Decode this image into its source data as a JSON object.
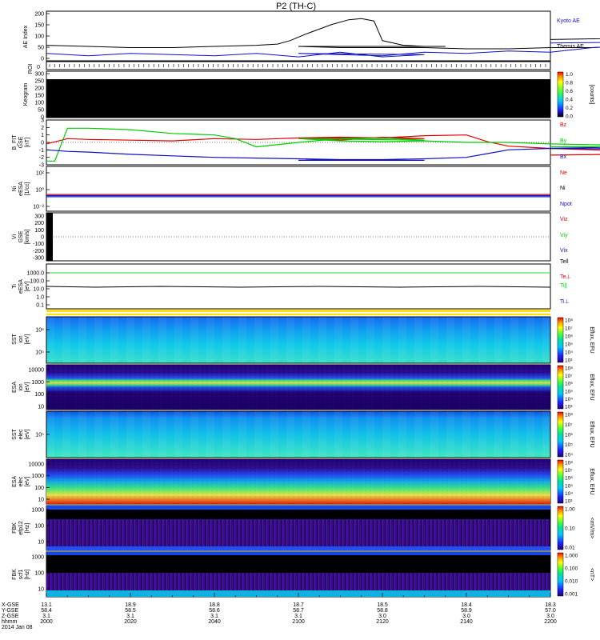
{
  "header": {
    "title": "P2 (TH-C)"
  },
  "chart_data": [
    {
      "type": "line",
      "panel": "ae_index",
      "ylabel": "AE Index",
      "ticks": [
        "200",
        "150",
        "100",
        "50",
        "0"
      ],
      "series": [
        {
          "name": "Themis AE",
          "color": "#000000",
          "x": [
            2000,
            2010,
            2020,
            2030,
            2040,
            2050,
            2055,
            2058,
            2062,
            2068,
            2072,
            2075,
            2078,
            2080,
            2085,
            2090,
            2095,
            2100,
            2110,
            2120,
            2130,
            2140,
            2150,
            2160,
            2170,
            2180,
            2185,
            2190,
            2195,
            2200
          ],
          "values": [
            60,
            55,
            50,
            50,
            55,
            60,
            65,
            80,
            110,
            150,
            170,
            175,
            165,
            80,
            60,
            55,
            55,
            55,
            50,
            50,
            50,
            45,
            45,
            50,
            50,
            60,
            75,
            90,
            95,
            85
          ]
        },
        {
          "name": "Kyoto AE",
          "color": "#1010c0",
          "x": [
            2000,
            2010,
            2020,
            2030,
            2040,
            2050,
            2060,
            2070,
            2080,
            2090,
            2100,
            2110,
            2120,
            2130,
            2140,
            2150,
            2160,
            2170,
            2180,
            2190,
            2200
          ],
          "values": [
            25,
            15,
            25,
            20,
            15,
            25,
            10,
            30,
            10,
            20,
            25,
            20,
            15,
            30,
            25,
            35,
            30,
            50,
            60,
            75,
            70
          ]
        }
      ]
    },
    {
      "type": "heatmap",
      "panel": "roi",
      "ylabel": "ROI",
      "ticks": [
        "0"
      ]
    },
    {
      "type": "heatmap",
      "panel": "keogram",
      "ylabel": "Keogram",
      "ticks": [
        "300",
        "250",
        "200",
        "150",
        "100",
        "50",
        "0"
      ],
      "colorbar": {
        "label": "[counts]",
        "ticks": [
          "1.0",
          "0.8",
          "0.6",
          "0.4",
          "0.2",
          "0.0"
        ]
      }
    },
    {
      "type": "line",
      "panel": "b_field",
      "ylabel": "B_FIT",
      "ylabel2": "GSE",
      "ylabel3": "[nT]",
      "ticks": [
        "3",
        "2",
        "1",
        "0",
        "-1",
        "-2",
        "-3"
      ],
      "ylim": [
        -3,
        3
      ],
      "series": [
        {
          "name": "Bz",
          "color": "#e00000",
          "x": [
            2000,
            2005,
            2010,
            2020,
            2030,
            2040,
            2050,
            2060,
            2070,
            2080,
            2090,
            2100,
            2110,
            2120,
            2130,
            2140,
            2145,
            2150,
            2160,
            2170,
            2180,
            2190,
            2200
          ],
          "values": [
            -0.2,
            0.5,
            0.4,
            0.3,
            0.2,
            0.5,
            0.4,
            0.6,
            0.3,
            0.7,
            0.5,
            0.6,
            0.7,
            0.6,
            0.9,
            1.0,
            0.1,
            -0.5,
            -0.8,
            -1.0,
            -1.3,
            -1.5,
            -1.7
          ]
        },
        {
          "name": "By",
          "color": "#00cc00",
          "x": [
            2000,
            2002,
            2005,
            2010,
            2020,
            2030,
            2040,
            2045,
            2050,
            2060,
            2070,
            2080,
            2090,
            2100,
            2110,
            2120,
            2130,
            2140,
            2150,
            2160,
            2170,
            2180,
            2190,
            2200
          ],
          "values": [
            -2.5,
            -2.5,
            1.9,
            1.9,
            1.7,
            1.2,
            1.0,
            0.5,
            -0.6,
            0.0,
            0.5,
            0.6,
            0.3,
            0.5,
            0.2,
            0.1,
            0.2,
            0.0,
            0.0,
            -0.2,
            -0.3,
            -0.4,
            -0.5,
            -0.6
          ]
        },
        {
          "name": "Bx",
          "color": "#1010c0",
          "x": [
            2000,
            2005,
            2010,
            2020,
            2030,
            2040,
            2050,
            2060,
            2070,
            2080,
            2090,
            2100,
            2110,
            2120,
            2130,
            2140,
            2145,
            2150,
            2160,
            2170,
            2180,
            2190,
            2200
          ],
          "values": [
            -1.0,
            -1.2,
            -1.3,
            -1.6,
            -1.8,
            -2.0,
            -2.1,
            -2.2,
            -2.3,
            -2.4,
            -2.4,
            -2.4,
            -2.3,
            -2.3,
            -2.2,
            -2.0,
            -1.5,
            -1.0,
            -0.8,
            -0.7,
            -0.9,
            -1.0,
            -0.8
          ]
        }
      ]
    },
    {
      "type": "line",
      "panel": "density",
      "ylabel": "Ni",
      "ylabel2": "eESA",
      "ylabel3": "[1/cc]",
      "ticks": [
        "10²",
        "10⁰",
        "10⁻²"
      ],
      "legend": [
        "Ne",
        "Ni",
        "Npot"
      ]
    },
    {
      "type": "line",
      "panel": "velocity",
      "ylabel": "Vi",
      "ylabel2": "GSE",
      "ylabel3": "[km/s]",
      "ticks": [
        "300",
        "200",
        "100",
        "0",
        "-100",
        "-200",
        "-300"
      ],
      "legend": [
        "Viz",
        "Viy",
        "Vix",
        "Tell"
      ]
    },
    {
      "type": "line",
      "panel": "temperature",
      "ylabel": "Ti",
      "ylabel2": "eESA",
      "ylabel3": "[eV]",
      "ticks": [
        "1000.0",
        "100.0",
        "10.0",
        "1.0",
        "0.1"
      ],
      "legend": [
        "Te⊥",
        "Ti∥",
        "Ti⊥"
      ]
    },
    {
      "type": "heatmap",
      "panel": "sst_ion",
      "ylabel": "SST",
      "ylabel2": "ion",
      "ylabel3": "[eV]",
      "ticks": [
        "10⁶",
        "10⁵"
      ],
      "colorbar": {
        "label": "Eflux, EFU",
        "ticks": [
          "10⁸",
          "10⁷",
          "10⁶",
          "10⁵",
          "10⁴",
          "10³"
        ]
      }
    },
    {
      "type": "heatmap",
      "panel": "esa_ion",
      "ylabel": "ESA",
      "ylabel2": "ion",
      "ylabel3": "[eV]",
      "ticks": [
        "10000",
        "1000",
        "100",
        "10"
      ],
      "colorbar": {
        "label": "Eflux, EFU",
        "ticks": [
          "10⁸",
          "10⁷",
          "10⁶",
          "10⁵",
          "10⁴",
          "10³"
        ]
      }
    },
    {
      "type": "heatmap",
      "panel": "sst_elec",
      "ylabel": "SST",
      "ylabel2": "elec",
      "ylabel3": "[eV]",
      "ticks": [
        "10⁵"
      ],
      "colorbar": {
        "label": "Eflux, EFU",
        "ticks": [
          "10⁸",
          "10⁷",
          "10⁶",
          "10⁵",
          "10⁴"
        ]
      }
    },
    {
      "type": "heatmap",
      "panel": "esa_elec",
      "ylabel": "ESA",
      "ylabel2": "elec",
      "ylabel3": "[eV]",
      "ticks": [
        "10000",
        "1000",
        "100",
        "10"
      ],
      "colorbar": {
        "label": "Eflux, EFU",
        "ticks": [
          "10⁸",
          "10⁷",
          "10⁶",
          "10⁵",
          "10⁴",
          "10³"
        ]
      }
    },
    {
      "type": "heatmap",
      "panel": "fbk_e12",
      "ylabel": "FBK",
      "ylabel2": "efp12",
      "ylabel3": "[Hz]",
      "ticks": [
        "1000",
        "100",
        "10"
      ],
      "colorbar": {
        "label": "<mV/m>",
        "ticks": [
          "1.00",
          "0.10",
          "0.01"
        ]
      }
    },
    {
      "type": "heatmap",
      "panel": "fbk_b",
      "ylabel": "FBK",
      "ylabel2": "scf1",
      "ylabel3": "[Hz]",
      "ticks": [
        "1000",
        "100",
        "10"
      ],
      "colorbar": {
        "label": "<nT>",
        "ticks": [
          "1.000",
          "0.100",
          "0.010",
          "0.001"
        ]
      }
    }
  ],
  "xaxis": {
    "row_labels": [
      "X-GSE",
      "Y-GSE",
      "Z-GSE",
      "hhmm",
      "2014 Jan 08"
    ],
    "columns": [
      {
        "x": 2000,
        "rows": [
          "13.1",
          "58.4",
          "3.1",
          "2000"
        ]
      },
      {
        "x": 2020,
        "rows": [
          "18.9",
          "58.5",
          "3.1",
          "2020"
        ]
      },
      {
        "x": 2040,
        "rows": [
          "18.8",
          "58.6",
          "3.1",
          "2040"
        ]
      },
      {
        "x": 2100,
        "rows": [
          "18.7",
          "58.7",
          "3.1",
          "2100"
        ]
      },
      {
        "x": 2120,
        "rows": [
          "18.5",
          "58.8",
          "3.0",
          "2120"
        ]
      },
      {
        "x": 2140,
        "rows": [
          "18.4",
          "58.9",
          "3.0",
          "2140"
        ]
      },
      {
        "x": 2200,
        "rows": [
          "18.3",
          "57.0",
          "3.0",
          "2200"
        ]
      }
    ]
  }
}
